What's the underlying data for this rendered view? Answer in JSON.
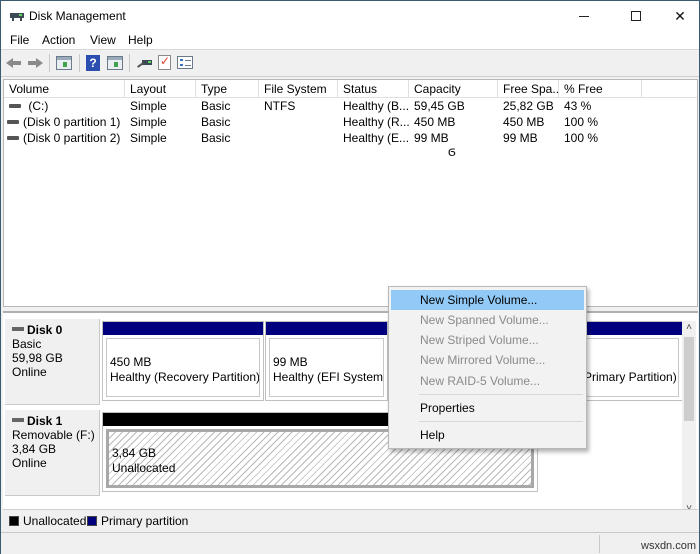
{
  "window": {
    "title": "Disk Management",
    "controls": {
      "minimize": "minimize",
      "maximize": "maximize",
      "close": "close"
    }
  },
  "menubar": {
    "items": [
      {
        "label": "File"
      },
      {
        "label": "Action"
      },
      {
        "label": "View"
      },
      {
        "label": "Help"
      }
    ]
  },
  "toolbar": {
    "icons": [
      "back-icon",
      "forward-icon",
      "show-hide-console-tree-icon",
      "help-icon",
      "show-hide-action-pane-icon",
      "connect-drive-icon",
      "check-icon",
      "properties-list-icon"
    ],
    "help_glyph": "?"
  },
  "volume_list": {
    "columns": [
      "Volume",
      "Layout",
      "Type",
      "File System",
      "Status",
      "Capacity",
      "Free Spa...",
      "% Free"
    ],
    "rows": [
      {
        "volume": " (C:)",
        "layout": "Simple",
        "type": "Basic",
        "file_system": "NTFS",
        "status": "Healthy (B...",
        "capacity": "59,45 GB",
        "free_space": "25,82 GB",
        "percent_free": "43 %"
      },
      {
        "volume": "(Disk 0 partition 1)",
        "layout": "Simple",
        "type": "Basic",
        "file_system": "",
        "status": "Healthy (R...",
        "capacity": "450 MB",
        "free_space": "450 MB",
        "percent_free": "100 %"
      },
      {
        "volume": "(Disk 0 partition 2)",
        "layout": "Simple",
        "type": "Basic",
        "file_system": "",
        "status": "Healthy (E...",
        "capacity": "99 MB",
        "free_space": "99 MB",
        "percent_free": "100 %"
      }
    ],
    "cursor_glyph": "ϭ"
  },
  "disks": [
    {
      "name": "Disk 0",
      "type": "Basic",
      "size": "59,98 GB",
      "state": "Online",
      "partitions": [
        {
          "size": "450 MB",
          "status": "Healthy (Recovery Partition)",
          "bar_color": "#00007f"
        },
        {
          "size": "99 MB",
          "status": "Healthy (EFI System Pa",
          "bar_color": "#00007f"
        },
        {
          "size": "",
          "status": "",
          "bar_color": "#00007f"
        },
        {
          "size": "",
          "status": "Primary Partition)",
          "bar_color": "#00007f"
        }
      ]
    },
    {
      "name": "Disk 1",
      "type": "Removable (F:)",
      "size": "3,84 GB",
      "state": "Online",
      "partitions": [
        {
          "size": "3,84 GB",
          "status": "Unallocated",
          "bar_color": "#000000"
        }
      ]
    }
  ],
  "scrollbar": {
    "up_glyph": "˄",
    "down_glyph": "˅"
  },
  "legend": [
    {
      "label": "Unallocated",
      "color": "#000000"
    },
    {
      "label": "Primary partition",
      "color": "#00007f"
    }
  ],
  "context_menu": {
    "items": [
      {
        "label": "New Simple Volume...",
        "state": "highlighted"
      },
      {
        "label": "New Spanned Volume...",
        "state": "disabled"
      },
      {
        "label": "New Striped Volume...",
        "state": "disabled"
      },
      {
        "label": "New Mirrored Volume...",
        "state": "disabled"
      },
      {
        "label": "New RAID-5 Volume...",
        "state": "disabled"
      },
      {
        "label": "Properties",
        "state": "enabled"
      },
      {
        "label": "Help",
        "state": "enabled"
      }
    ]
  },
  "watermark": "wsxdn.com"
}
